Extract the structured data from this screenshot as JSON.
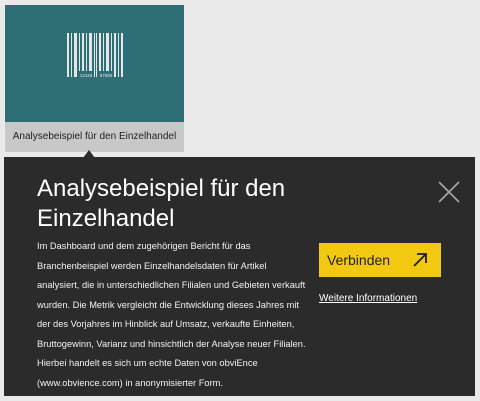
{
  "tile": {
    "caption": "Analysebeispiel für den Einzelhandel",
    "barcode_left_digits": "12345",
    "barcode_right_digits": "67890",
    "image_color": "#2e6f75"
  },
  "flyout": {
    "title": "Analysebeispiel für den Einzelhandel",
    "description": "Im Dashboard und dem zugehörigen Bericht für das Branchenbeispiel werden Einzelhandelsdaten für Artikel analysiert, die in unterschiedlichen Filialen und Gebieten verkauft wurden. Die Metrik vergleicht die Entwicklung dieses Jahres mit der des Vorjahres im Hinblick auf Umsatz, verkaufte Einheiten, Bruttogewinn, Varianz und hinsichtlich der Analyse neuer Filialen. Hierbei handelt es sich um echte Daten von obviEnce (www.obvience.com) in anonymisierter Form.",
    "connect_label": "Verbinden",
    "more_info_label": "Weitere Informationen",
    "close_icon": "close-icon",
    "accent_color": "#f2c811",
    "background_color": "#2b2b2b"
  }
}
